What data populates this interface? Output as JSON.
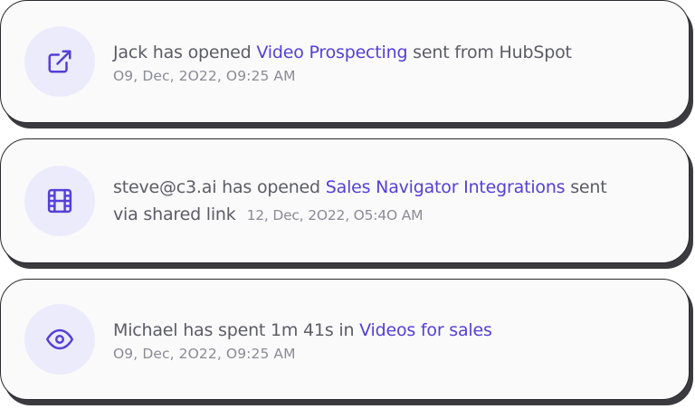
{
  "notifications": [
    {
      "icon": "external-link-icon",
      "actor": "Jack",
      "action": " has opened ",
      "item": "Video Prospecting",
      "suffix": " sent from HubSpot",
      "timestamp": "O9, Dec, 2O22, O9:25 AM"
    },
    {
      "icon": "film-icon",
      "actor": "steve@c3.ai",
      "action": " has opened ",
      "item": "Sales Navigator Integrations",
      "suffix": " sent",
      "suffix_line2": "via shared link",
      "timestamp": "12, Dec, 2O22, O5:4O AM"
    },
    {
      "icon": "eye-icon",
      "actor": "Michael",
      "action": " has spent 1m 41s in ",
      "item": "Videos for sales",
      "suffix": "",
      "timestamp": "O9, Dec, 2O22, O9:25 AM"
    }
  ],
  "colors": {
    "accent": "#5540d6",
    "icon_bg": "#ecebfb",
    "card_bg": "#fafafa",
    "text": "#5c5c66",
    "muted": "#8b8b95"
  }
}
